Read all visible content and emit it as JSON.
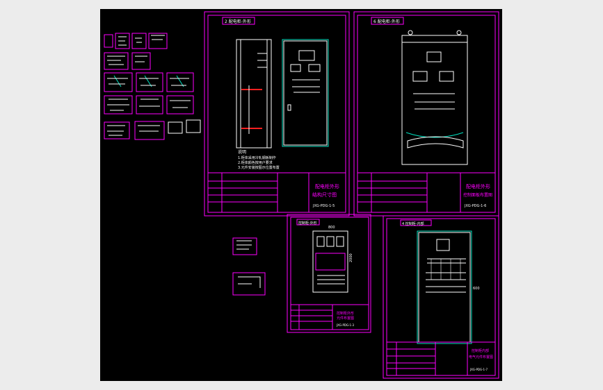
{
  "sheets": {
    "a": {
      "tag": "2 配电柜-外形",
      "title_l1": "配电柜外形",
      "title_l2": "结构尺寸图",
      "code": "JXG-PDG-1-5"
    },
    "b": {
      "tag": "6 配电柜-外形",
      "title_l1": "配电柜外形",
      "title_l2": "控制面板布置图",
      "code": "JXG-PDG-1-6"
    },
    "c": {
      "tag": "控制柜-外形",
      "title_l1": "控制柜外形",
      "title_l2": "元件布置图",
      "code": "JXG-PDG-1-3"
    },
    "d": {
      "tag": "4 控制柜-内部",
      "title_l1": "控制柜内部",
      "title_l2": "电气元件布置图",
      "code": "JXG-PDG-1-7"
    }
  },
  "notes": {
    "heading": "说明",
    "lines": [
      "1.柜体采用冷轧钢板制作",
      "2.柜体颜色按用户要求",
      "3.元件安装按图示位置布置"
    ]
  },
  "dims": {
    "d1": "2000",
    "d2": "800",
    "d3": "600"
  },
  "colors": {
    "background": "#000000",
    "frame": "#ff00ff",
    "line": "#ffffff",
    "accent": "#00e0c0",
    "highlight": "#ff2020"
  }
}
